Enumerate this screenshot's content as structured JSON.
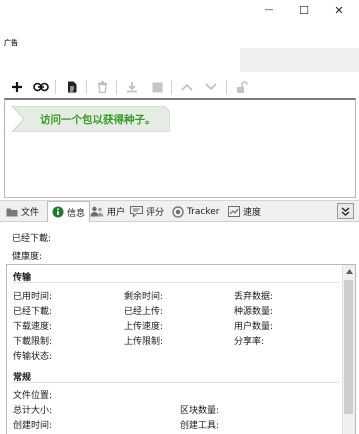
{
  "window": {
    "controls": {
      "minimize": "—",
      "maximize": "☐",
      "close": "✕"
    }
  },
  "ad": {
    "label": "广告"
  },
  "toolbar": {
    "buttons": [
      {
        "name": "add-torrent-button",
        "icon": "plus-icon"
      },
      {
        "name": "add-link-button",
        "icon": "link-icon"
      },
      {
        "name": "create-torrent-button",
        "icon": "file-icon"
      },
      {
        "name": "remove-button",
        "icon": "trash-icon"
      },
      {
        "name": "download-button",
        "icon": "download-icon"
      },
      {
        "name": "stop-button",
        "icon": "stop-icon"
      },
      {
        "name": "move-up-button",
        "icon": "chevron-up-icon"
      },
      {
        "name": "move-down-button",
        "icon": "chevron-down-icon"
      },
      {
        "name": "unlock-button",
        "icon": "unlock-icon"
      }
    ]
  },
  "hint": {
    "text": "访问一个包以获得种子。"
  },
  "tabs": [
    {
      "label": "文件",
      "icon": "folder-icon"
    },
    {
      "label": "信息",
      "icon": "info-icon",
      "active": true
    },
    {
      "label": "用户",
      "icon": "users-icon"
    },
    {
      "label": "评分",
      "icon": "rating-icon"
    },
    {
      "label": "Tracker",
      "icon": "tracker-icon"
    },
    {
      "label": "速度",
      "icon": "speed-icon"
    }
  ],
  "summary": {
    "downloaded_label": "已经下載:",
    "health_label": "健康度:"
  },
  "transfer": {
    "title": "传输",
    "col1": [
      "已用时间:",
      "已经下載:",
      "下载速度:",
      "下載限制:",
      "传输状态:"
    ],
    "col2": [
      "剩余时间:",
      "已经上传:",
      "上传速度:",
      "上传限制:"
    ],
    "col3": [
      "丢弃数据:",
      "种源数量:",
      "用户数量:",
      "分享率:"
    ]
  },
  "general": {
    "title": "常规",
    "location_label": "文件位置:",
    "total_size_label": "总计大小:",
    "created_time_label": "创建时间:",
    "block_count_label": "区块数量:",
    "created_tool_label": "创建工具:"
  },
  "colors": {
    "accent_green": "#3a9a2a",
    "info_blue": "#1f7a2a"
  }
}
